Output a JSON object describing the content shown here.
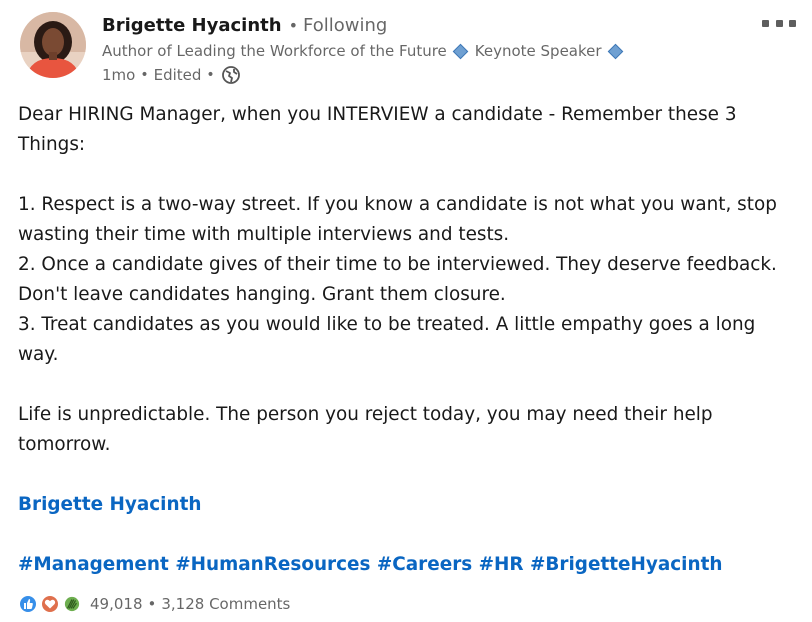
{
  "author": {
    "name": "Brigette Hyacinth",
    "follow_state": "Following",
    "headline_part1": "Author of Leading the Workforce of the Future",
    "headline_part2": "Keynote Speaker",
    "time_ago": "1mo",
    "edited_label": "Edited",
    "visibility_icon": "globe-icon"
  },
  "menu": {
    "icon": "more-options-icon"
  },
  "post": {
    "intro": "Dear HIRING Manager, when you INTERVIEW a candidate - Remember these 3 Things:",
    "point1": "1. Respect is a two-way street. If you know a candidate is not what you want, stop wasting their time with multiple interviews and tests.",
    "point2": "2. Once a candidate gives of their time to be interviewed. They deserve feedback. Don't leave candidates hanging. Grant them closure.",
    "point3": "3. Treat candidates as you would like to be treated. A little empathy goes a long way.",
    "closing": "Life is unpredictable. The person you reject today, you may need their help tomorrow.",
    "mention": "Brigette Hyacinth",
    "hashtags": [
      "#Management",
      "#HumanResources",
      "#Careers",
      "#HR",
      "#BrigetteHyacinth"
    ]
  },
  "social": {
    "reaction_icons": [
      "like-icon",
      "love-icon",
      "celebrate-icon"
    ],
    "reaction_count": "49,018",
    "separator": "•",
    "comments": "3,128 Comments"
  },
  "colors": {
    "link": "#0a66c2",
    "secondary_text": "#666666",
    "like": "#378fe9",
    "love": "#df704d",
    "celebrate": "#44712e"
  }
}
